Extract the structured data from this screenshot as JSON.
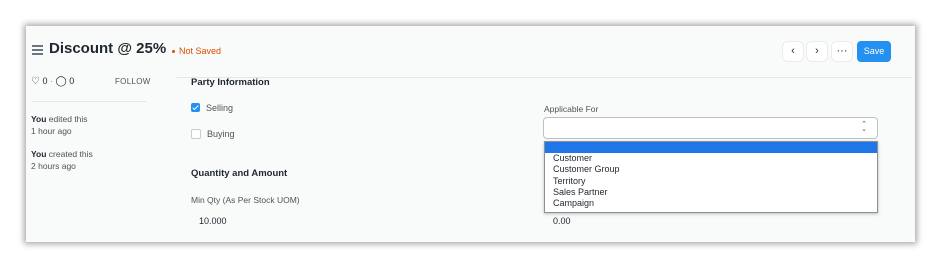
{
  "header": {
    "title": "Discount @ 25%",
    "status": "Not Saved",
    "prev_icon": "‹",
    "next_icon": "›",
    "more_icon": "···",
    "save_label": "Save"
  },
  "sidebar": {
    "likes_count": "0",
    "comments_count": "0",
    "follow_label": "FOLLOW",
    "timeline": [
      {
        "actor": "You",
        "action": " edited this",
        "time": "1 hour ago"
      },
      {
        "actor": "You",
        "action": " created this",
        "time": "2 hours ago"
      }
    ]
  },
  "party_section": {
    "title": "Party Information",
    "selling_label": "Selling",
    "selling_checked": true,
    "buying_label": "Buying",
    "buying_checked": false,
    "applicable_for_label": "Applicable For",
    "applicable_for_value": "",
    "options": [
      "",
      "Customer",
      "Customer Group",
      "Territory",
      "Sales Partner",
      "Campaign"
    ]
  },
  "qty_section": {
    "title": "Quantity and Amount",
    "min_qty_label": "Min Qty (As Per Stock UOM)",
    "min_qty_value": "10.000",
    "second_value": "0.00"
  },
  "colors": {
    "accent": "#2490ef",
    "status": "#e24c00",
    "dropdown_highlight": "#1e76e8"
  }
}
